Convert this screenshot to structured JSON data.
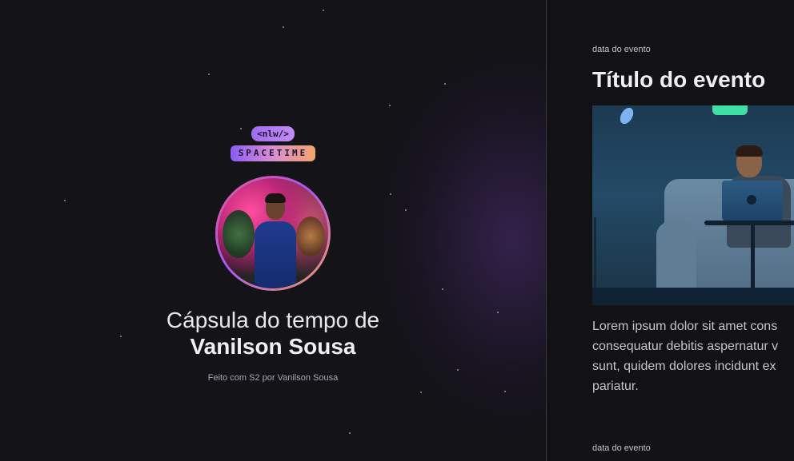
{
  "brand": {
    "logo_top": "<nlw/>",
    "logo_bottom": "SPACETIME"
  },
  "profile": {
    "title_prefix": "Cápsula do tempo de",
    "name": "Vanilson Sousa",
    "credit": "Feito com S2 por Vanilson Sousa"
  },
  "events": [
    {
      "date_label": "data do evento",
      "title": "Título do evento",
      "description_lines": [
        "Lorem ipsum dolor sit amet cons",
        "consequatur debitis aspernatur v",
        "sunt, quidem dolores incidunt ex",
        "pariatur."
      ]
    },
    {
      "date_label": "data do evento"
    }
  ],
  "colors": {
    "background": "#121215",
    "logo_gradient_start": "#8b5cf6",
    "logo_gradient_end": "#f4a36b",
    "avatar_ring_start": "#e25d8a",
    "avatar_ring_end": "#f59e5b",
    "text_primary": "#f0f0f3",
    "text_secondary": "#c4c4cc"
  }
}
